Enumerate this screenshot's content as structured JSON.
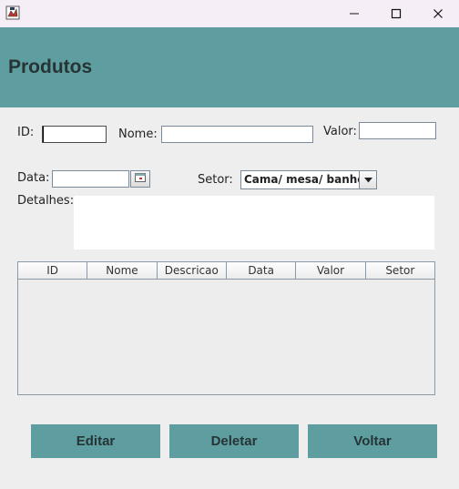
{
  "window": {
    "minimize_icon": "minimize-icon",
    "maximize_icon": "maximize-icon",
    "close_icon": "close-icon"
  },
  "header": {
    "title": "Produtos",
    "bg_color": "#5f9ea0"
  },
  "form": {
    "id_label": "ID:",
    "id_value": "",
    "nome_label": "Nome:",
    "nome_value": "",
    "valor_label": "Valor:",
    "valor_value": "",
    "data_label": "Data:",
    "data_value": "",
    "setor_label": "Setor:",
    "setor_selected": "Cama/ mesa/ banho",
    "detalhes_label": "Detalhes:",
    "detalhes_value": ""
  },
  "table": {
    "columns": [
      "ID",
      "Nome",
      "Descricao",
      "Data",
      "Valor",
      "Setor"
    ],
    "rows": []
  },
  "buttons": {
    "editar": "Editar",
    "deletar": "Deletar",
    "voltar": "Voltar"
  }
}
